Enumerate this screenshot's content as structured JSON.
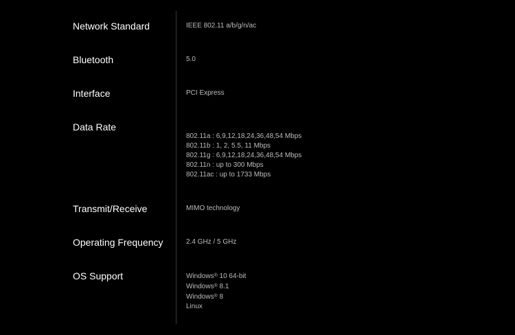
{
  "colors": {
    "background": "#000000",
    "label": "#ffffff",
    "value": "#bdbdbd",
    "divider": "#3a3a3a"
  },
  "specs": [
    {
      "label": "Network Standard",
      "values": [
        "IEEE 802.11 a/b/g/n/ac"
      ]
    },
    {
      "label": "Bluetooth",
      "values": [
        "5.0"
      ]
    },
    {
      "label": "Interface",
      "values": [
        "PCI Express"
      ]
    },
    {
      "label": "Data Rate",
      "values": [
        "802.11a : 6,9,12,18,24,36,48,54 Mbps",
        "802.11b : 1, 2, 5.5, 11 Mbps",
        "802.11g : 6,9,12,18,24,36,48,54 Mbps",
        "802.11n : up to 300 Mbps",
        "802.11ac : up to 1733 Mbps"
      ]
    },
    {
      "label": "Transmit/Receive",
      "values": [
        "MIMO technology"
      ]
    },
    {
      "label": "Operating Frequency",
      "values": [
        "2.4 GHz / 5 GHz"
      ]
    },
    {
      "label": "OS Support",
      "values": [
        "Windows",
        "Windows",
        "Windows",
        "Linux"
      ],
      "suffixes": [
        " 10 64-bit",
        " 8.1",
        " 8",
        ""
      ],
      "reg_mark": "®"
    }
  ]
}
